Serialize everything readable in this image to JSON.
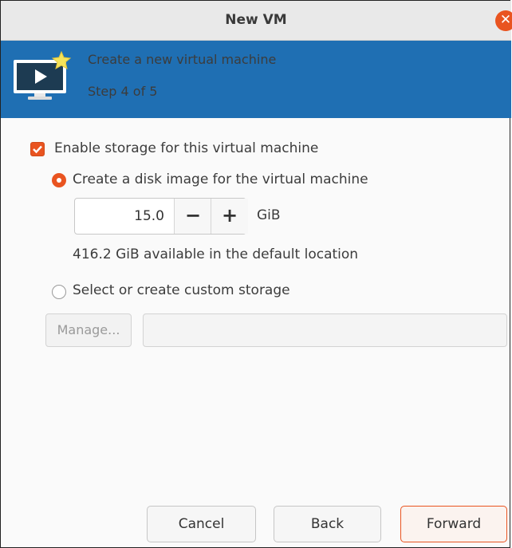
{
  "window": {
    "title": "New VM",
    "close_icon": "close-icon",
    "accent_color": "#e95420",
    "header_color": "#1f6fb3"
  },
  "header": {
    "icon": "vm-display-icon",
    "title": "Create a new virtual machine",
    "step": "Step 4 of 5"
  },
  "storage": {
    "enable_label": "Enable storage for this virtual machine",
    "enable_checked": true,
    "create_disk_label": "Create a disk image for the virtual machine",
    "create_disk_selected": true,
    "disk_size_value": "15.0",
    "decrement_label": "−",
    "increment_label": "+",
    "unit": "GiB",
    "available_text": "416.2 GiB available in the default location",
    "custom_storage_label": "Select or create custom storage",
    "custom_storage_selected": false,
    "manage_label": "Manage...",
    "custom_path_value": ""
  },
  "footer": {
    "cancel_label": "Cancel",
    "back_label": "Back",
    "forward_label": "Forward"
  }
}
